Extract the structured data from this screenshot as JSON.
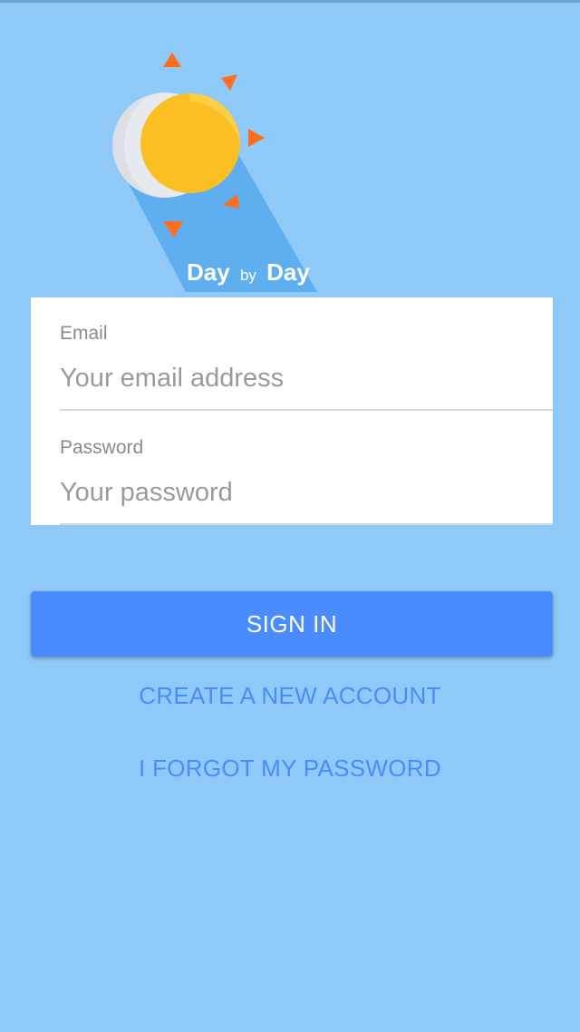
{
  "colors": {
    "background": "#8fc9f7",
    "accent": "#4a8cff",
    "card": "#ffffff",
    "sun": "#fbbf24",
    "moon": "#e6e9ee",
    "rays": "#ff6d1f"
  },
  "logo": {
    "text_day1": "Day",
    "text_by": "by",
    "text_day2": "Day"
  },
  "form": {
    "email": {
      "label": "Email",
      "placeholder": "Your email address",
      "value": ""
    },
    "password": {
      "label": "Password",
      "placeholder": "Your password",
      "value": ""
    }
  },
  "actions": {
    "sign_in": "SIGN IN",
    "create_account": "CREATE A NEW ACCOUNT",
    "forgot_password": "I FORGOT MY PASSWORD"
  }
}
